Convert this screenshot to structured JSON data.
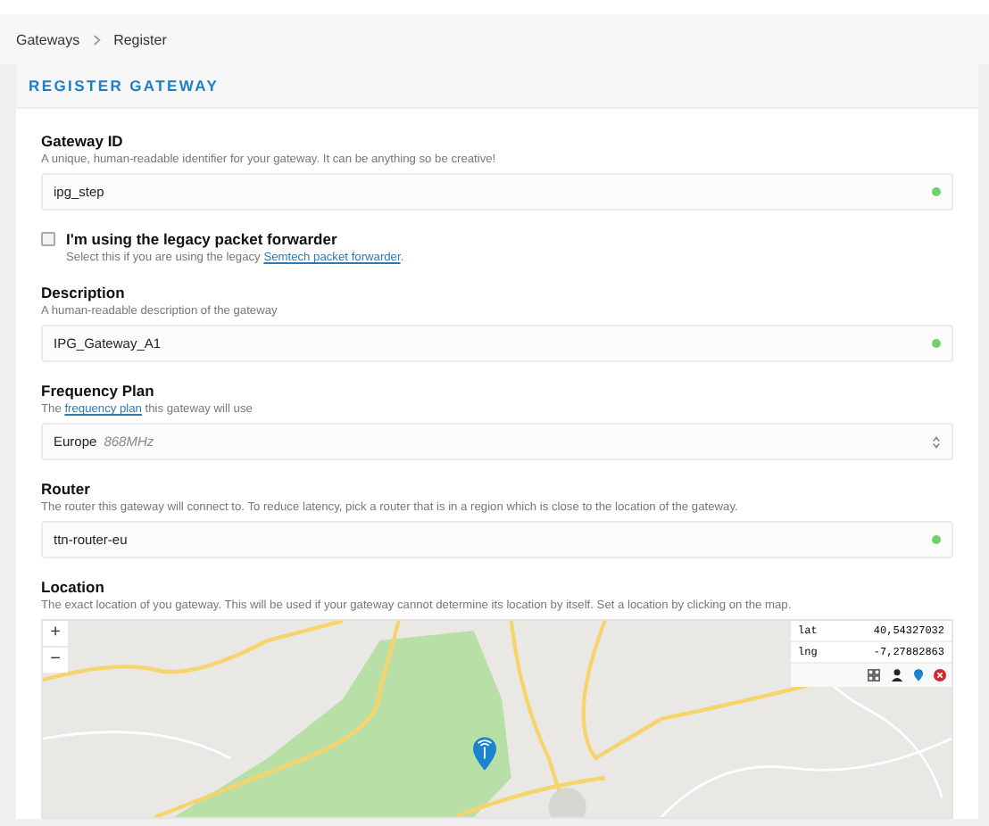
{
  "breadcrumbs": [
    {
      "label": "Gateways"
    },
    {
      "label": "Register"
    }
  ],
  "card": {
    "title": "REGISTER GATEWAY"
  },
  "fields": [
    {
      "kind": "text",
      "label": "Gateway ID",
      "hint": {
        "text": "A unique, human-readable identifier for your gateway. It can be anything so be creative!"
      },
      "value": "ipg_step",
      "valid": true
    },
    {
      "kind": "checkbox",
      "label": "I'm using the legacy packet forwarder",
      "hint": {
        "text": "Select this if you are using the legacy ",
        "link": "Semtech packet forwarder",
        "after": "."
      },
      "checked": false
    },
    {
      "kind": "text",
      "label": "Description",
      "hint": {
        "text": "A human-readable description of the gateway"
      },
      "value": "IPG_Gateway_A1",
      "valid": true
    },
    {
      "kind": "select",
      "label": "Frequency Plan",
      "hint": {
        "text": "The ",
        "link": "frequency plan",
        "after": " this gateway will use"
      },
      "value": "Europe",
      "detail": "868MHz"
    },
    {
      "kind": "text",
      "label": "Router",
      "hint": {
        "text": "The router this gateway will connect to. To reduce latency, pick a router that is in a region which is close to the location of the gateway."
      },
      "value": "ttn-router-eu",
      "valid": true
    },
    {
      "kind": "map",
      "label": "Location",
      "hint": {
        "text": "The exact location of you gateway. This will be used if your gateway cannot determine its location by itself. Set a location by clicking on the map."
      },
      "zoom_in": "+",
      "zoom_out": "−",
      "coords": [
        {
          "label": "lat",
          "value": "40,54327032"
        },
        {
          "label": "lng",
          "value": "-7,27882863"
        }
      ]
    }
  ]
}
